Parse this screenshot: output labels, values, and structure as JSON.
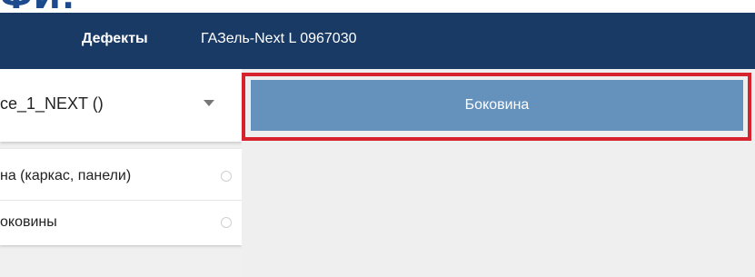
{
  "top_banner": {
    "text": "ФИ:"
  },
  "appbar": {
    "title": "Дефекты",
    "subtitle": "ГАЗель-Next L 0967030",
    "color": "#1a3a66"
  },
  "selector": {
    "value": "ce_1_NEXT ()",
    "icon": "dropdown-arrow-icon"
  },
  "list": {
    "items": [
      {
        "label": "на (каркас, панели)",
        "icon": "radio-unchecked-icon"
      },
      {
        "label": "оковины",
        "icon": "radio-unchecked-icon"
      }
    ]
  },
  "main": {
    "button_label": "Боковина",
    "button_color": "#6591bd",
    "highlight_color": "#d7232e"
  }
}
